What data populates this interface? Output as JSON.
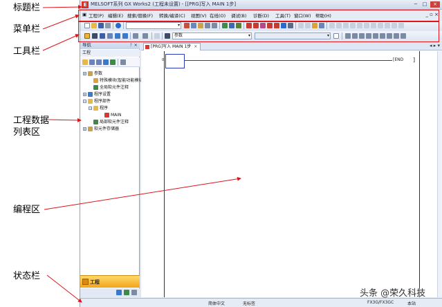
{
  "annotations": {
    "title_bar": "标题栏",
    "menu_bar": "菜单栏",
    "tool_bar": "工具栏",
    "project_list": "工程数据列表区",
    "project_list_line1": "工程数据",
    "project_list_line2": "列表区",
    "programming_area": "编程区",
    "status_bar": "状态栏"
  },
  "window": {
    "title": "MELSOFT系列 GX Works2 (工程未设置) - [[PRG]写入 MAIN 1步]",
    "controls": [
      "−",
      "□",
      "×"
    ]
  },
  "menu": {
    "items": [
      "工程(P)",
      "编辑(E)",
      "搜索/替换(F)",
      "转换/编译(C)",
      "视图(V)",
      "在线(O)",
      "调试(B)",
      "诊断(D)",
      "工具(T)",
      "窗口(W)",
      "帮助(H)"
    ],
    "right_controls": "_ ▫ ×"
  },
  "toolbar": {
    "combo1": "",
    "combo2": "参数",
    "combo3": ""
  },
  "nav": {
    "header": "导航",
    "pin": "ᚹ ×",
    "subheader": "工程",
    "tree": [
      {
        "label": "参数",
        "indent": 0,
        "box": "+"
      },
      {
        "label": "特殊模块(智能功能模块)",
        "indent": 1,
        "box": ""
      },
      {
        "label": "全局软元件注释",
        "indent": 1,
        "box": ""
      },
      {
        "label": "程序设置",
        "indent": 0,
        "box": "+"
      },
      {
        "label": "程序部件",
        "indent": 0,
        "box": "−"
      },
      {
        "label": "程序",
        "indent": 1,
        "box": "−"
      },
      {
        "label": "MAIN",
        "indent": 3,
        "box": ""
      },
      {
        "label": "局部软元件注释",
        "indent": 1,
        "box": ""
      },
      {
        "label": "软元件存储器",
        "indent": 0,
        "box": "+"
      }
    ],
    "bottom_tab": "工程"
  },
  "editor": {
    "tab_label": "[PRG]写入 MAIN 1步",
    "tab_close": "×",
    "tab_nav": "◂ ▸ ▾",
    "step_number": "0",
    "end_instruction": "[END",
    "end_bracket": "]"
  },
  "status": {
    "language": "简体中文",
    "label": "无标签",
    "plc": "FX3G/FX3GC",
    "station": "本站"
  },
  "watermark": "头条 @荣久科技",
  "colors": {
    "annotation_red": "#e0121a",
    "window_bg": "#dfe7f3",
    "nav_tab": "#f2a51b"
  }
}
